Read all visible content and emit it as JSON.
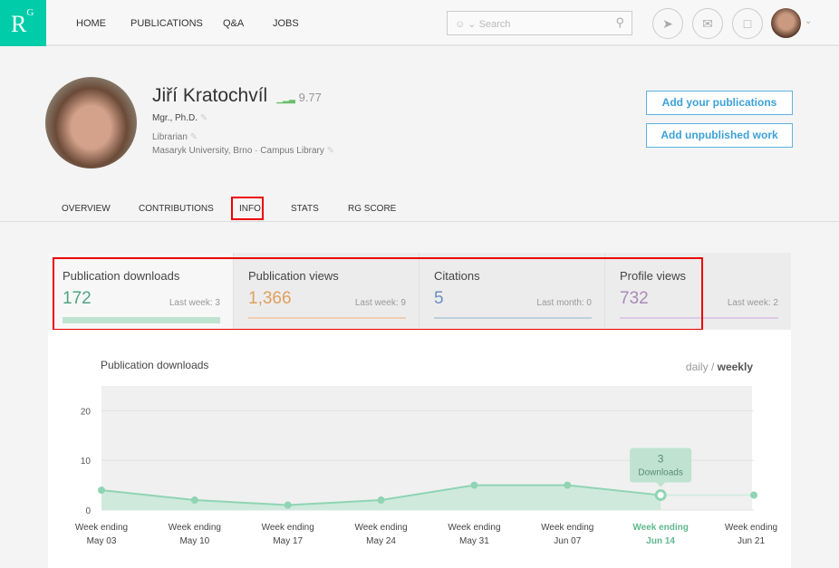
{
  "nav": {
    "logo": "R",
    "logo_sup": "G",
    "items": [
      "HOME",
      "PUBLICATIONS",
      "Q&A",
      "JOBS"
    ],
    "search_placeholder": "Search"
  },
  "profile": {
    "name": "Jiří Kratochvíl",
    "rg_score": "9.77",
    "degree": "Mgr., Ph.D.",
    "position": "Librarian",
    "institution": "Masaryk University, Brno · Campus Library"
  },
  "buttons": {
    "add_publications": "Add your publications",
    "add_unpublished": "Add unpublished work"
  },
  "tabs": [
    "OVERVIEW",
    "CONTRIBUTIONS",
    "INFO",
    "STATS",
    "RG SCORE"
  ],
  "stats": [
    {
      "label": "Publication downloads",
      "value": "172",
      "last": "Last week: 3",
      "color": "#5fb88f"
    },
    {
      "label": "Publication views",
      "value": "1,366",
      "last": "Last week: 9",
      "color": "#e0a060"
    },
    {
      "label": "Citations",
      "value": "5",
      "last": "Last month: 0",
      "color": "#6a90c0"
    },
    {
      "label": "Profile views",
      "value": "732",
      "last": "Last week: 2",
      "color": "#a98ab8"
    }
  ],
  "chart_data": {
    "type": "area",
    "title": "Publication downloads",
    "toggle_daily": "daily",
    "toggle_sep": " / ",
    "toggle_weekly": "weekly",
    "categories": [
      [
        "Week ending",
        "May 03"
      ],
      [
        "Week ending",
        "May 10"
      ],
      [
        "Week ending",
        "May 17"
      ],
      [
        "Week ending",
        "May 24"
      ],
      [
        "Week ending",
        "May 31"
      ],
      [
        "Week ending",
        "Jun 07"
      ],
      [
        "Week ending",
        "Jun 14"
      ],
      [
        "Week ending",
        "Jun 21"
      ]
    ],
    "values": [
      4,
      2,
      1,
      2,
      5,
      5,
      3,
      3
    ],
    "ylim": [
      0,
      25
    ],
    "yticks": [
      "0",
      "10",
      "20"
    ],
    "highlight_index": 6,
    "tooltip": {
      "value": "3",
      "label": "Downloads"
    },
    "color": "#8fd4b4",
    "grid": true
  }
}
